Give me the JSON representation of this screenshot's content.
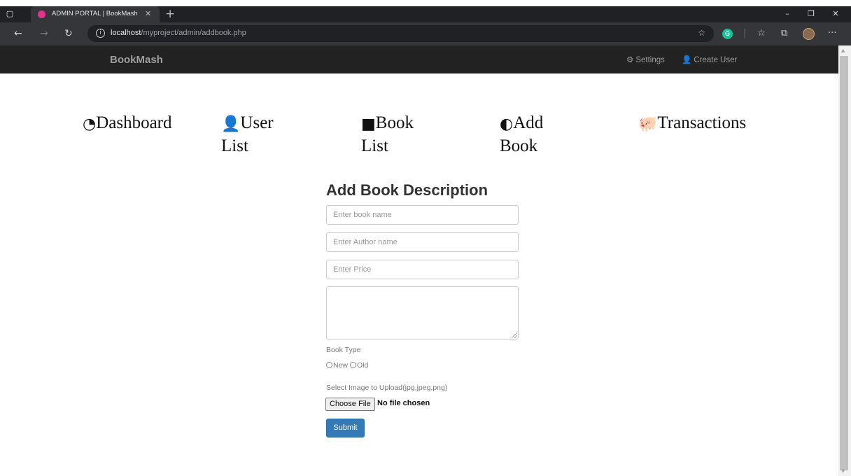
{
  "browser": {
    "tab_title": "ADMIN PORTAL | BookMash",
    "url_host": "localhost",
    "url_path": "/myproject/admin/addbook.php"
  },
  "navbar": {
    "brand": "BookMash",
    "settings_label": "Settings",
    "create_user_label": "Create User"
  },
  "menu": {
    "dashboard": "Dashboard",
    "user_list_1": "User",
    "user_list_2": "List",
    "book_list_1": "Book",
    "book_list_2": "List",
    "add_book_1": "Add",
    "add_book_2": "Book",
    "transactions": "Transactions"
  },
  "form": {
    "title": "Add Book Description",
    "book_name_placeholder": "Enter book name",
    "author_placeholder": "Enter Author name",
    "price_placeholder": "Enter Price",
    "book_type_label": "Book Type",
    "option_new": "New",
    "option_old": "Old",
    "upload_label": "Select Image to Upload(jpg,jpeg,png)",
    "choose_file_label": "Choose File",
    "no_file_label": "No file chosen",
    "submit_label": "Submit"
  },
  "colors": {
    "navbar_bg": "#222222",
    "primary_button": "#337ab7",
    "favicon": "#e0338f",
    "grammarly": "#15c39a"
  },
  "icons": {
    "settings": "gear-icon",
    "create_user": "user-icon",
    "dashboard": "dashboard-icon",
    "user_list": "user-icon",
    "book_list": "book-icon",
    "add_book": "contrast-icon",
    "transactions": "piggy-bank-icon"
  }
}
